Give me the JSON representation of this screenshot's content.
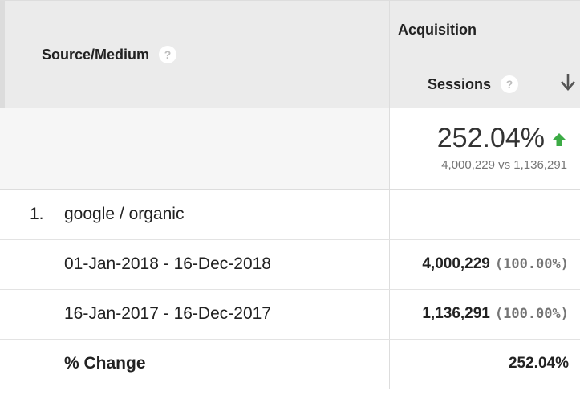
{
  "header": {
    "source_medium_label": "Source/Medium",
    "help_glyph": "?",
    "group_label": "Acquisition",
    "metric_label": "Sessions",
    "sort_icon": "arrow-down-icon"
  },
  "summary": {
    "change_percent": "252.04%",
    "comparison": "4,000,229 vs 1,136,291",
    "trend_icon": "arrow-up-icon",
    "trend_color": "#3cab45"
  },
  "rows": [
    {
      "index": "1.",
      "source": "google / organic"
    },
    {
      "range": "01-Jan-2018 - 16-Dec-2018",
      "sessions": "4,000,229",
      "share": "(100.00%)"
    },
    {
      "range": "16-Jan-2017 - 16-Dec-2017",
      "sessions": "1,136,291",
      "share": "(100.00%)"
    },
    {
      "label": "% Change",
      "value": "252.04%"
    }
  ]
}
